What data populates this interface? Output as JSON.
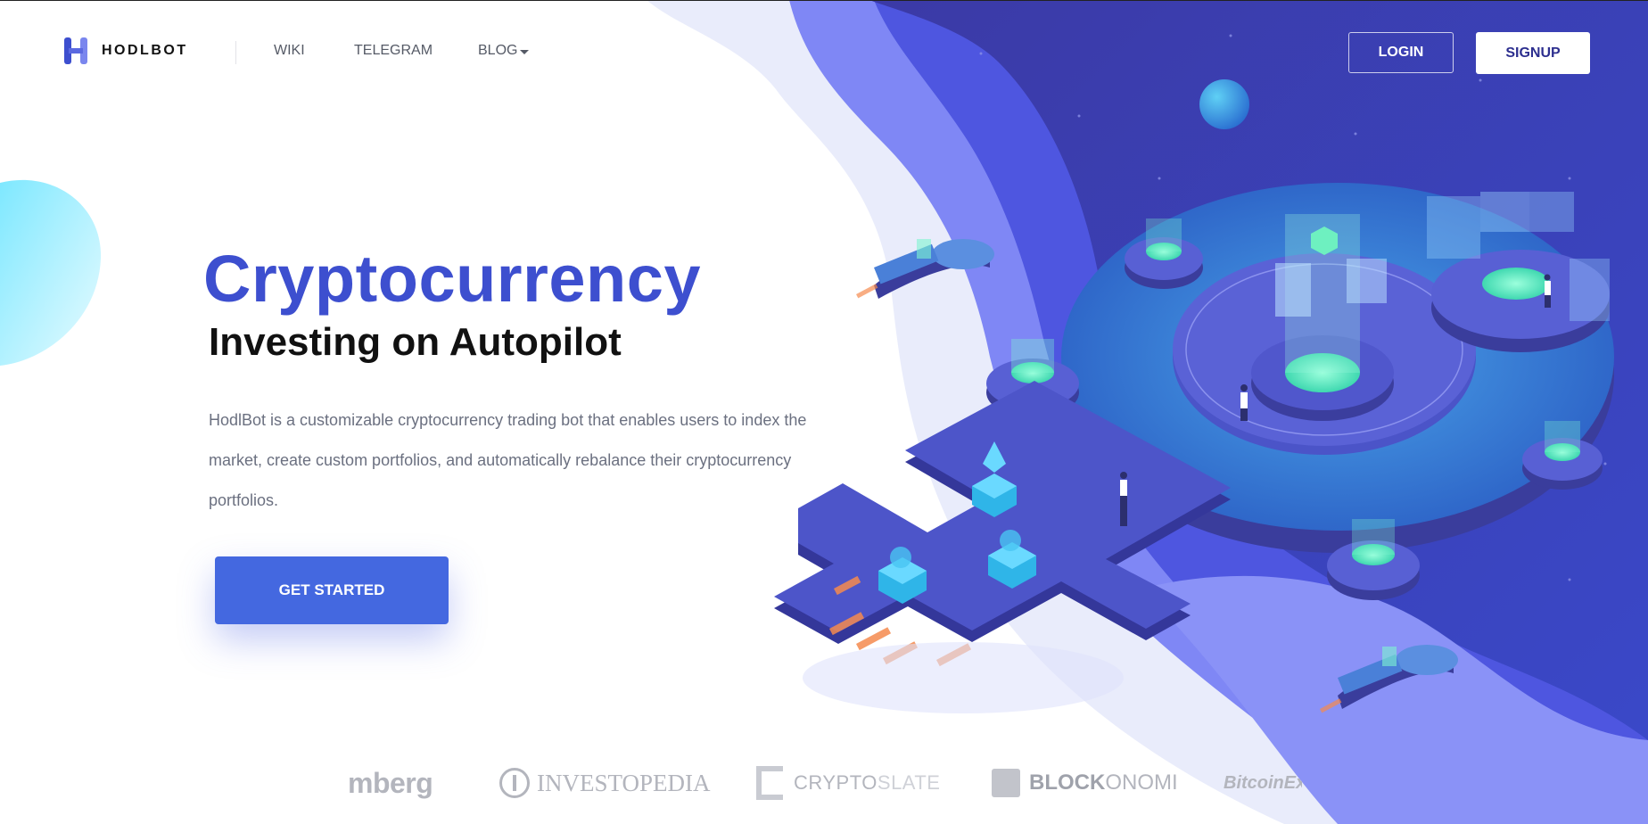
{
  "brand": {
    "name": "HODLBOT"
  },
  "nav": {
    "links": [
      "WIKI",
      "TELEGRAM",
      "BLOG"
    ],
    "login_label": "LOGIN",
    "signup_label": "SIGNUP"
  },
  "hero": {
    "title": "Cryptocurrency",
    "subtitle": "Investing on Autopilot",
    "description": "HodlBot is a customizable cryptocurrency trading bot that enables users to index the market, create custom portfolios, and automatically rebalance their cryptocurrency portfolios.",
    "cta_label": "GET STARTED"
  },
  "press": {
    "logos": [
      "mberg",
      "INVESTOPEDIA",
      "CRYPTOSLATE",
      "BLOCKONOMI",
      "BitcoinExchangeGuide"
    ],
    "p3_bold": "CRYPTO",
    "p3_rest": "SLATE",
    "p4_bold": "BLOCK",
    "p4_rest": "ONOMI",
    "p5_visible": "BitcoinEx"
  },
  "colors": {
    "primary": "#3d4fcf",
    "cta": "#4468e0",
    "deep_purple": "#3f3fa8",
    "teal_glow": "#6ef0c0"
  },
  "icons": [
    "hodlbot-logo-icon",
    "chevron-down-icon",
    "bitcoin-icon",
    "ripple-icon",
    "ethereum-icon"
  ]
}
